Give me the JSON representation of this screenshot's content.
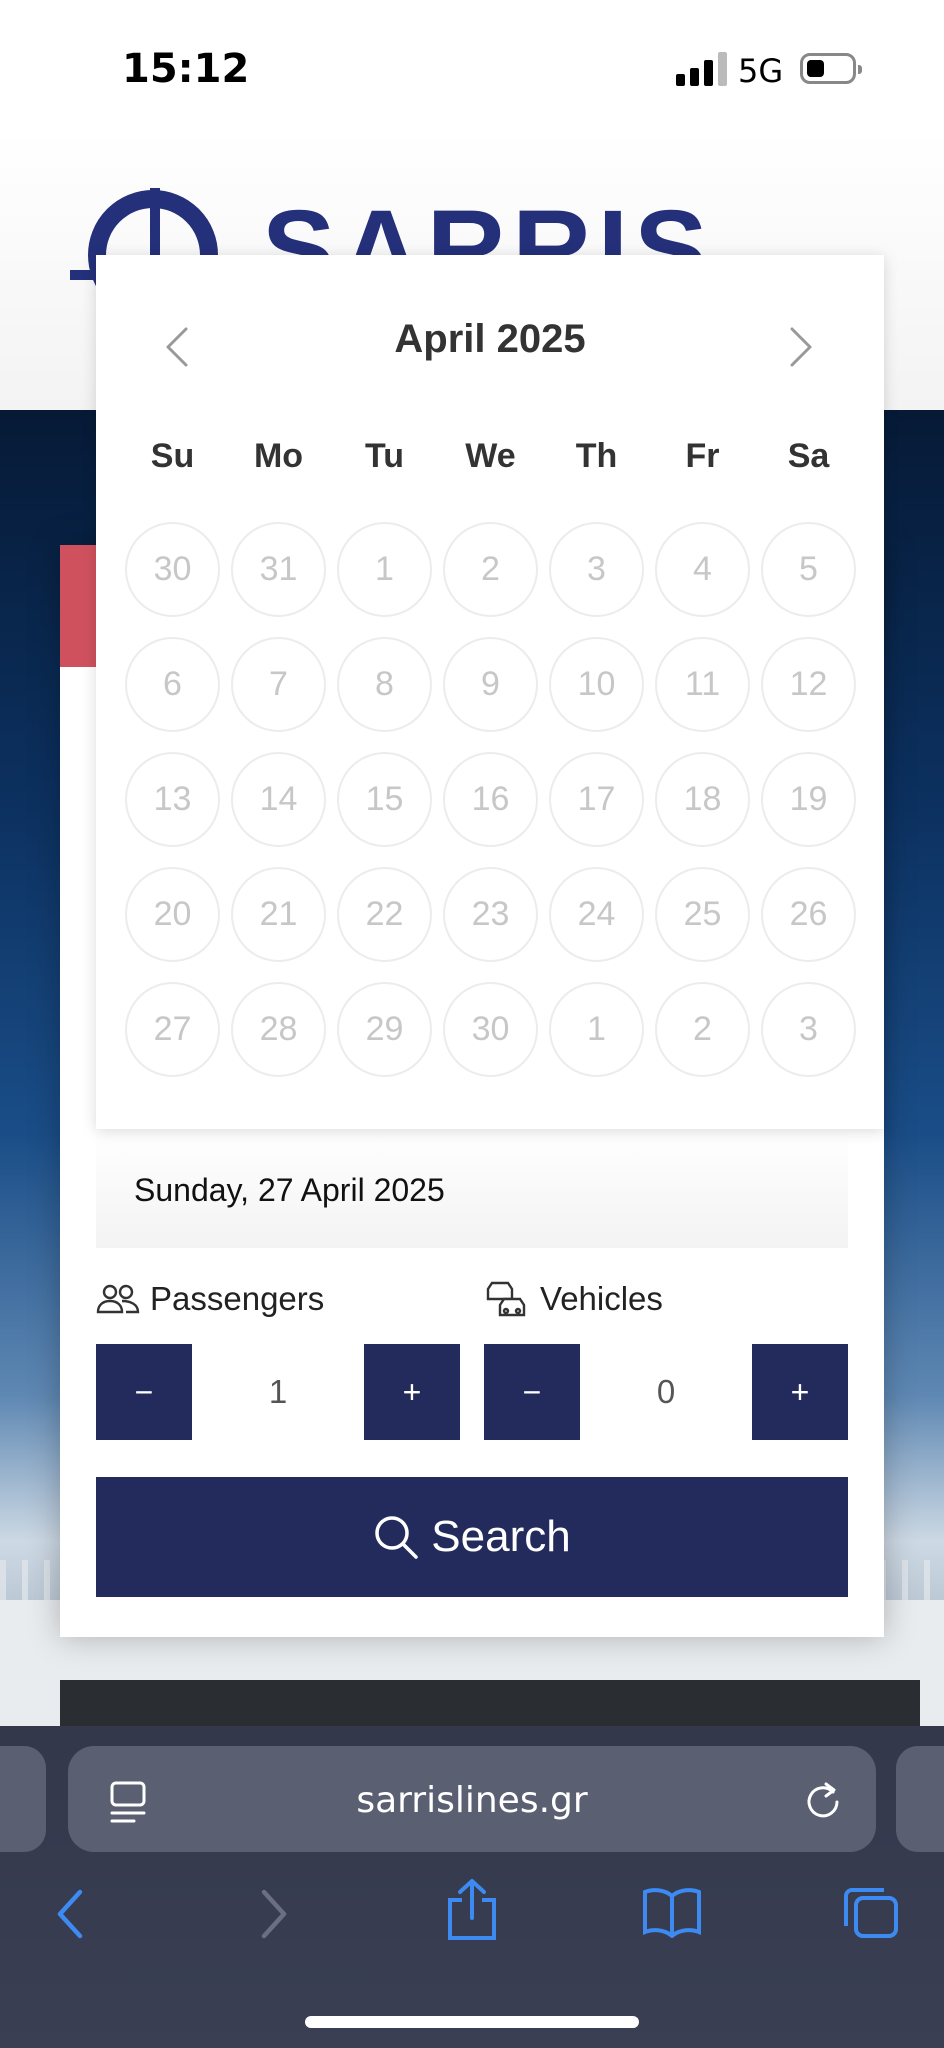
{
  "status_bar": {
    "time": "15:12",
    "network": "5G"
  },
  "brand": {
    "logo_text": "SARRIS"
  },
  "calendar": {
    "month_title": "April 2025",
    "weekdays": [
      "Su",
      "Mo",
      "Tu",
      "We",
      "Th",
      "Fr",
      "Sa"
    ],
    "days": [
      "30",
      "31",
      "1",
      "2",
      "3",
      "4",
      "5",
      "6",
      "7",
      "8",
      "9",
      "10",
      "11",
      "12",
      "13",
      "14",
      "15",
      "16",
      "17",
      "18",
      "19",
      "20",
      "21",
      "22",
      "23",
      "24",
      "25",
      "26",
      "27",
      "28",
      "29",
      "30",
      "1",
      "2",
      "3"
    ]
  },
  "booking": {
    "selected_date": "Sunday, 27 April 2025",
    "passengers": {
      "label": "Passengers",
      "value": "1",
      "minus": "−",
      "plus": "+"
    },
    "vehicles": {
      "label": "Vehicles",
      "value": "0",
      "minus": "−",
      "plus": "+"
    },
    "search_label": "Search"
  },
  "browser": {
    "url": "sarrislines.gr"
  },
  "colors": {
    "brand_navy": "#232b5c",
    "accent_red": "#d0515e",
    "safari_blue": "#3d8bf2"
  }
}
